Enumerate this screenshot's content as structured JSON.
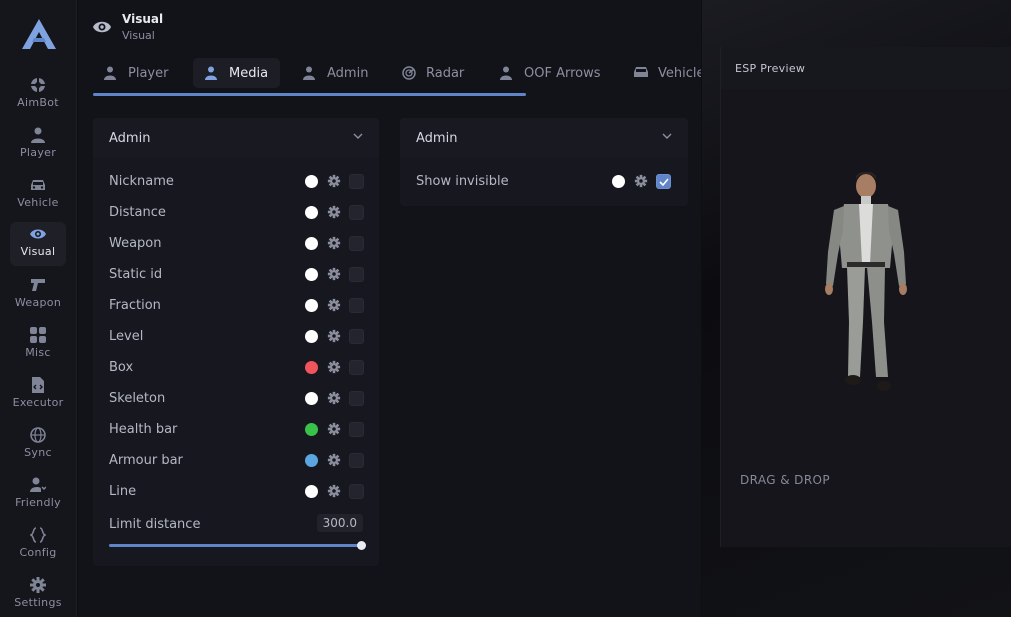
{
  "sidebar": {
    "items": [
      {
        "label": "AimBot",
        "icon": "crosshair-icon"
      },
      {
        "label": "Player",
        "icon": "user-icon"
      },
      {
        "label": "Vehicle",
        "icon": "car-icon"
      },
      {
        "label": "Visual",
        "icon": "eye-icon",
        "active": true
      },
      {
        "label": "Weapon",
        "icon": "gun-icon"
      },
      {
        "label": "Misc",
        "icon": "grid-icon"
      },
      {
        "label": "Executor",
        "icon": "file-code-icon"
      },
      {
        "label": "Sync",
        "icon": "globe-icon"
      },
      {
        "label": "Friendly",
        "icon": "user-heart-icon"
      },
      {
        "label": "Config",
        "icon": "braces-icon"
      },
      {
        "label": "Settings",
        "icon": "gear-icon"
      }
    ]
  },
  "header": {
    "title": "Visual",
    "subtitle": "Visual"
  },
  "tabs": [
    {
      "label": "Player"
    },
    {
      "label": "Media",
      "active": true
    },
    {
      "label": "Admin"
    },
    {
      "label": "Radar"
    },
    {
      "label": "OOF Arrows"
    },
    {
      "label": "Vehicle"
    }
  ],
  "left_card": {
    "dropdown": "Admin",
    "rows": [
      {
        "label": "Nickname",
        "color": "#ffffff",
        "checked": false
      },
      {
        "label": "Distance",
        "color": "#ffffff",
        "checked": false
      },
      {
        "label": "Weapon",
        "color": "#ffffff",
        "checked": false
      },
      {
        "label": "Static id",
        "color": "#ffffff",
        "checked": false
      },
      {
        "label": "Fraction",
        "color": "#ffffff",
        "checked": false
      },
      {
        "label": "Level",
        "color": "#ffffff",
        "checked": false
      },
      {
        "label": "Box",
        "color": "#f0545c",
        "checked": false
      },
      {
        "label": "Skeleton",
        "color": "#ffffff",
        "checked": false
      },
      {
        "label": "Health bar",
        "color": "#38c24a",
        "checked": false
      },
      {
        "label": "Armour bar",
        "color": "#5ba6e0",
        "checked": false
      },
      {
        "label": "Line",
        "color": "#ffffff",
        "checked": false
      }
    ],
    "limit_label": "Limit distance",
    "limit_value": "300.0",
    "limit_fraction": 1.0
  },
  "right_card": {
    "dropdown": "Admin",
    "rows": [
      {
        "label": "Show invisible",
        "color": "#ffffff",
        "checked": true
      }
    ]
  },
  "preview": {
    "title": "ESP Preview",
    "drag_label": "DRAG & DROP"
  },
  "colors": {
    "accent": "#5f84c8"
  }
}
